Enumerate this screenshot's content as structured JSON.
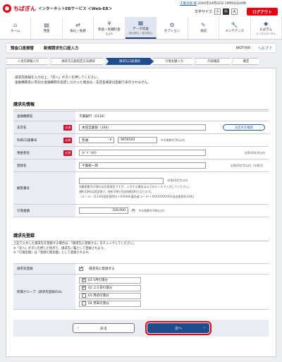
{
  "header": {
    "brand": "ちばぎん",
    "service": "インターネットEBサービス ＜Web-EB＞",
    "user_name": "千葉太郎 様",
    "login_time": "20XX年04月02日 10時00分00秒",
    "font_size_label": "文字サイズ",
    "sizes": [
      "小",
      "中",
      "大"
    ],
    "logout": "ログアウト"
  },
  "gnav": [
    {
      "icon": "home-icon",
      "glyph": "⌂",
      "label": "ホーム",
      "sub": ""
    },
    {
      "icon": "deposit-icon",
      "glyph": "▤",
      "label": "預金",
      "sub": ""
    },
    {
      "icon": "transfer-icon",
      "glyph": "⇄",
      "label": "振込・振替",
      "sub": ""
    },
    {
      "icon": "tax-icon",
      "glyph": "¥",
      "label": "税金・各種料金",
      "sub": "払込み"
    },
    {
      "icon": "data-icon",
      "glyph": "▦",
      "label": "データ伝送",
      "sub": "(総合振込・給与振込)"
    },
    {
      "icon": "option-icon",
      "glyph": "⚙",
      "label": "オプション",
      "sub": ""
    },
    {
      "icon": "approve-icon",
      "glyph": "✎",
      "label": "承認",
      "sub": ""
    },
    {
      "icon": "maint-icon",
      "glyph": "🔧",
      "label": "メンテナンス",
      "sub": ""
    },
    {
      "icon": "chibagin-icon",
      "glyph": "◆",
      "label": "ちばぎん",
      "sub": "ビジネスポータル"
    }
  ],
  "page": {
    "title": "預金口座振替",
    "subtitle": "新規請求先口座入力",
    "id": "BKZF008",
    "help": "ヘルプ ?"
  },
  "steps": [
    "入金先情報入力",
    "請求先口座指定方法選択",
    "請求先口座選択",
    "引落金額入力",
    "内容確認",
    "確定"
  ],
  "intro": [
    "請求先情報を入力の上、「次へ」ボタンを押してください。",
    "金融機関名に有効な金融機関を指定しなかった場合は、支店名検索は自動で表示されません。"
  ],
  "billing": {
    "section": "請求先情報",
    "bank_label": "金融機関名",
    "bank_value": "千葉銀行（0134）",
    "branch_label": "支店名",
    "branch_value": "本店営業部（100）",
    "branch_button": "支店名を検索",
    "account_label": "科目/口座番号",
    "account_type": "普通",
    "account_no": "9876543",
    "account_note": "※半角数字7桁以内",
    "holder_label": "預金者名",
    "holder_value": "ﾁﾊﾞｷﾞﾝﾀﾛｳ",
    "holder_note": "全角30文字以内",
    "reg_label": "登録名",
    "reg_value": "千葉統一郎",
    "reg_note": "全角30文字以内（半角可）",
    "cust_label": "顧客番号",
    "cust_note_top": "半角20文字以内",
    "cust_note": "※顧客番号(20桁)は任意項目ですが、入力する場合は以下のルールで入力してください。",
    "cust_note2": "頭桁10桁は固定値で、他桁10桁が自由使用桁となります。",
    "cust_note3": "（ルール）1113A(固定値5桁)＋XXXXX(委託者コード)＋XXXXXXXXXX(自由使用桁10桁)",
    "amount_label": "引落金額",
    "amount_value": "328,000",
    "amount_unit": "円",
    "amount_note": "※半角数字10桁以内"
  },
  "register": {
    "section": "請求先登録",
    "note1": "上記で入力した請求先を登録する場合は、「請求先に登録する」をチェックしてください。",
    "note2": "※「次へ」ボタンを押した時点で、請求先一覧として登録されます。",
    "note3": "※「引落金額」は「登録引落金額」として登録されます。",
    "reg_label": "請求先登録",
    "reg_check": "請求先に登録する",
    "group_label": "所属グループ（請求先登録のみ）",
    "groups": [
      {
        "label": "01 4月引落分",
        "checked": "✔"
      },
      {
        "label": "02 ２０日引落分",
        "checked": "✔"
      },
      {
        "label": "03 月初引落分",
        "checked": ""
      },
      {
        "label": "04 月末引落分",
        "checked": ""
      }
    ]
  },
  "footer": {
    "back": "戻る",
    "next": "次へ"
  }
}
